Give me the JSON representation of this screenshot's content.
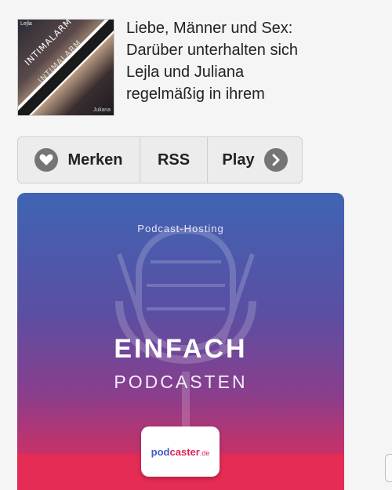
{
  "podcast": {
    "cover_text": "INTIMALARM",
    "cover_text_2": "INTIMALARM",
    "cover_tag": "Lejla",
    "cover_tag_2": "Juliana",
    "description": "Liebe, Männer und Sex: Darüber unterhalten sich Lejla und Juliana regelmäßig in ihrem"
  },
  "actions": {
    "merken_label": "Merken",
    "rss_label": "RSS",
    "play_label": "Play"
  },
  "ad": {
    "subtitle": "Podcast-Hosting",
    "title_line1": "EINFACH",
    "title_line2": "PODCASTEN",
    "logo_pod": "pod",
    "logo_caster": "caster",
    "logo_tld": ".de"
  },
  "colors": {
    "ad_gradient_top": "#3f64b4",
    "ad_gradient_bottom": "#dd2d55",
    "icon_gray": "#757575"
  }
}
